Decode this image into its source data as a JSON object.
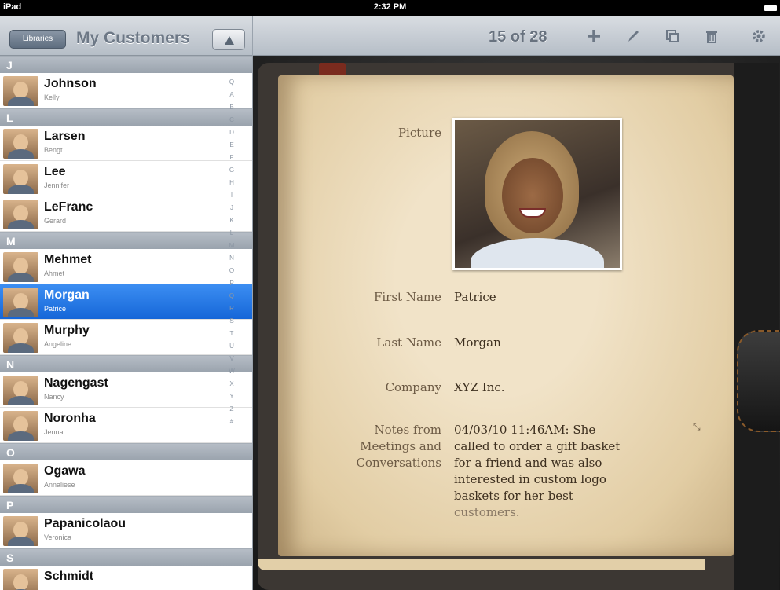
{
  "status_bar": {
    "device": "iPad",
    "time": "2:32 PM"
  },
  "sidebar": {
    "libraries_label": "Libraries",
    "title": "My Customers",
    "sections": [
      {
        "letter": "J",
        "items": [
          {
            "last": "Johnson",
            "first": "Kelly"
          }
        ]
      },
      {
        "letter": "L",
        "items": [
          {
            "last": "Larsen",
            "first": "Bengt"
          },
          {
            "last": "Lee",
            "first": "Jennifer"
          },
          {
            "last": "LeFranc",
            "first": "Gerard"
          }
        ]
      },
      {
        "letter": "M",
        "items": [
          {
            "last": "Mehmet",
            "first": "Ahmet"
          },
          {
            "last": "Morgan",
            "first": "Patrice",
            "selected": true
          },
          {
            "last": "Murphy",
            "first": "Angeline"
          }
        ]
      },
      {
        "letter": "N",
        "items": [
          {
            "last": "Nagengast",
            "first": "Nancy"
          },
          {
            "last": "Noronha",
            "first": "Jenna"
          }
        ]
      },
      {
        "letter": "O",
        "items": [
          {
            "last": "Ogawa",
            "first": "Annaliese"
          }
        ]
      },
      {
        "letter": "P",
        "items": [
          {
            "last": "Papanicolaou",
            "first": "Veronica"
          }
        ]
      },
      {
        "letter": "S",
        "items": [
          {
            "last": "Schmidt",
            "first": ""
          }
        ]
      }
    ],
    "index_letters": [
      "Q",
      "A",
      "B",
      "C",
      "D",
      "E",
      "F",
      "G",
      "H",
      "I",
      "J",
      "K",
      "L",
      "M",
      "N",
      "O",
      "P",
      "Q",
      "R",
      "S",
      "T",
      "U",
      "V",
      "W",
      "X",
      "Y",
      "Z",
      "#"
    ]
  },
  "toolbar": {
    "counter": "15 of 28",
    "icons": [
      "add-icon",
      "edit-icon",
      "duplicate-icon",
      "trash-icon",
      "gear-icon"
    ]
  },
  "record": {
    "picture_label": "Picture",
    "fields": [
      {
        "label": "First Name",
        "value": "Patrice"
      },
      {
        "label": "Last Name",
        "value": "Morgan"
      },
      {
        "label": "Company",
        "value": "XYZ Inc."
      }
    ],
    "notes_label_lines": [
      "Notes from",
      "Meetings and",
      "Conversations"
    ],
    "notes_lines": [
      "04/03/10 11:46AM: She",
      "called to order a gift basket",
      "for a friend and was also",
      "interested in custom logo",
      "baskets for her best",
      "customers."
    ]
  },
  "colors": {
    "accent": "#1566d8",
    "toolbar": "#c8ced5",
    "paper": "#ecdcbd"
  }
}
